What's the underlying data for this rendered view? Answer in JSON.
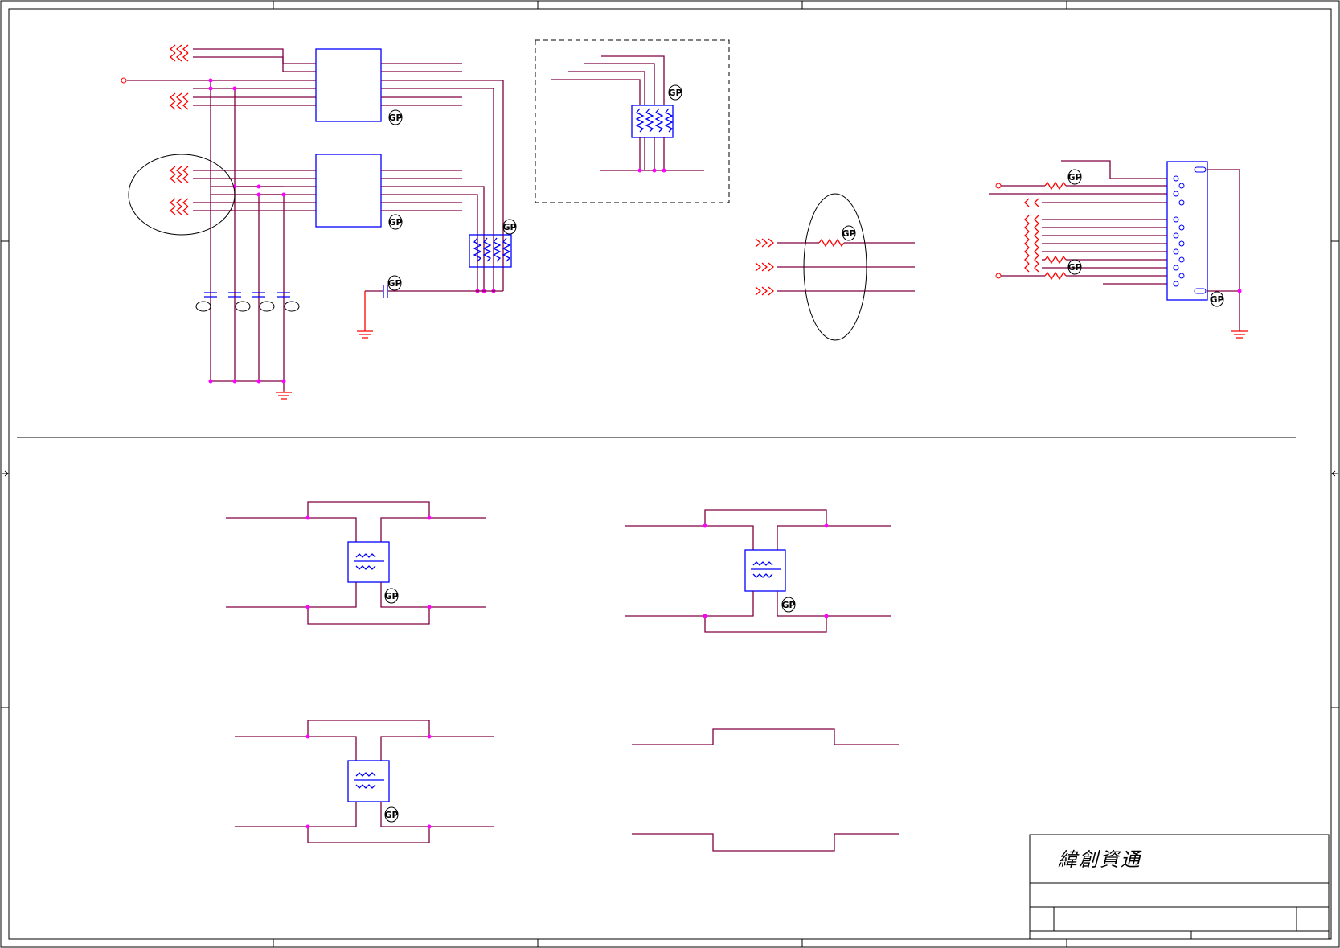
{
  "title_block": {
    "company_name": "緯創資通"
  },
  "part_markers": {
    "marker_text": "GP",
    "count": 12
  },
  "sections": [
    "decoupling-and-ferrite-networks",
    "signal-bridges"
  ],
  "colors": {
    "wire": "#800040",
    "pin_stub": "#ff0000",
    "component": "#0000ff",
    "junction": "#ff00ff",
    "frame": "#000000"
  },
  "icons": [
    "offpage-connector-icon",
    "ground-icon",
    "capacitor-icon",
    "resistor-icon",
    "resistor-array-icon",
    "common-mode-choke-icon",
    "connector-icon",
    "gp-marker-icon"
  ]
}
